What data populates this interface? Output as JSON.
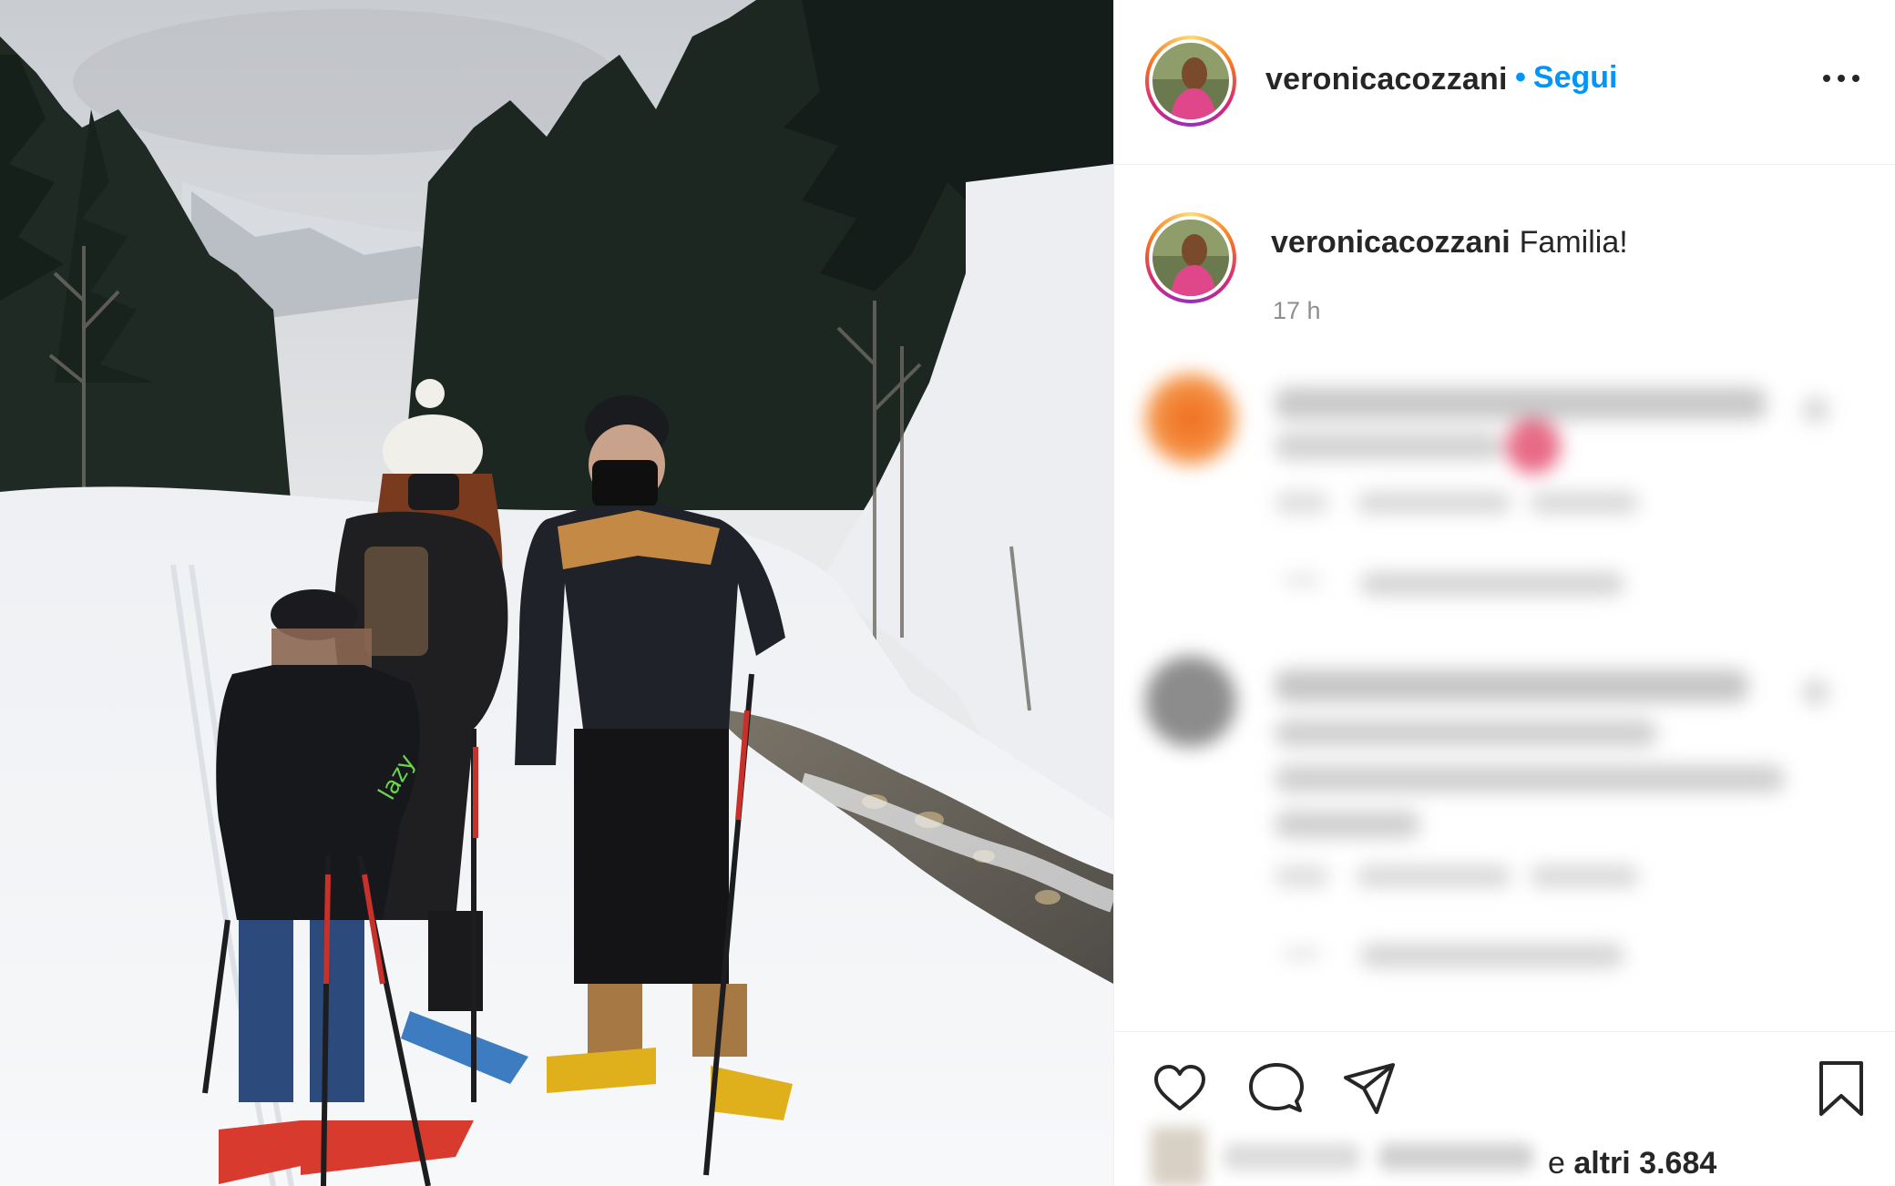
{
  "post": {
    "author": "veronicacozzani",
    "follow_label": "Segui",
    "follow_separator": "•",
    "more_icon": "more-horizontal-icon",
    "caption_text": "Familia!",
    "timestamp": "17 h"
  },
  "actions": {
    "icons": [
      "heart-icon",
      "comment-icon",
      "share-icon",
      "bookmark-icon"
    ],
    "likes_prefix": "e",
    "likes_label": "altri 3.684"
  },
  "colors": {
    "link": "#0095f6",
    "text": "#262626",
    "muted": "#8e8e8e",
    "border": "#efefef"
  }
}
